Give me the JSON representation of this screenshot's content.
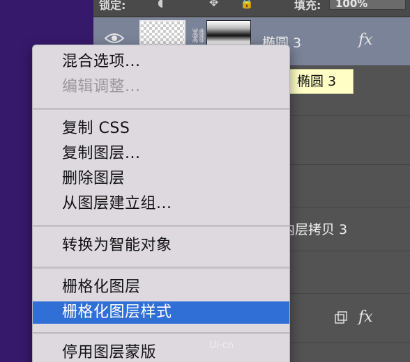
{
  "toolbar": {
    "lock_label": "锁定:",
    "fill_value": "100%",
    "fill_label": "填充:"
  },
  "layers": [
    {
      "name": "椭圆 3",
      "selected": true,
      "fx": "fx"
    },
    {
      "name": "内层拷贝 3",
      "selected": false
    },
    {
      "name": "",
      "selected": false,
      "fx": "fx"
    }
  ],
  "tooltip": {
    "text": "椭圆 3"
  },
  "context_menu": {
    "items": [
      {
        "label": "混合选项...",
        "disabled": false
      },
      {
        "label": "编辑调整...",
        "disabled": true
      },
      {
        "label": "复制 CSS",
        "disabled": false
      },
      {
        "label": "复制图层...",
        "disabled": false
      },
      {
        "label": "删除图层",
        "disabled": false
      },
      {
        "label": "从图层建立组...",
        "disabled": false
      },
      {
        "label": "转换为智能对象",
        "disabled": false
      },
      {
        "label": "栅格化图层",
        "disabled": false
      },
      {
        "label": "栅格化图层样式",
        "disabled": false,
        "highlighted": true
      },
      {
        "label": "停用图层蒙版",
        "disabled": false
      }
    ]
  },
  "colors": {
    "canvas_bg": "#37196b",
    "panel_bg": "#535353",
    "selected_row": "#7a8398",
    "menu_bg": "#ddd9df",
    "menu_highlight": "#2f6fd6",
    "tooltip_bg": "#ffffc5"
  },
  "watermark": "Ui·cn"
}
